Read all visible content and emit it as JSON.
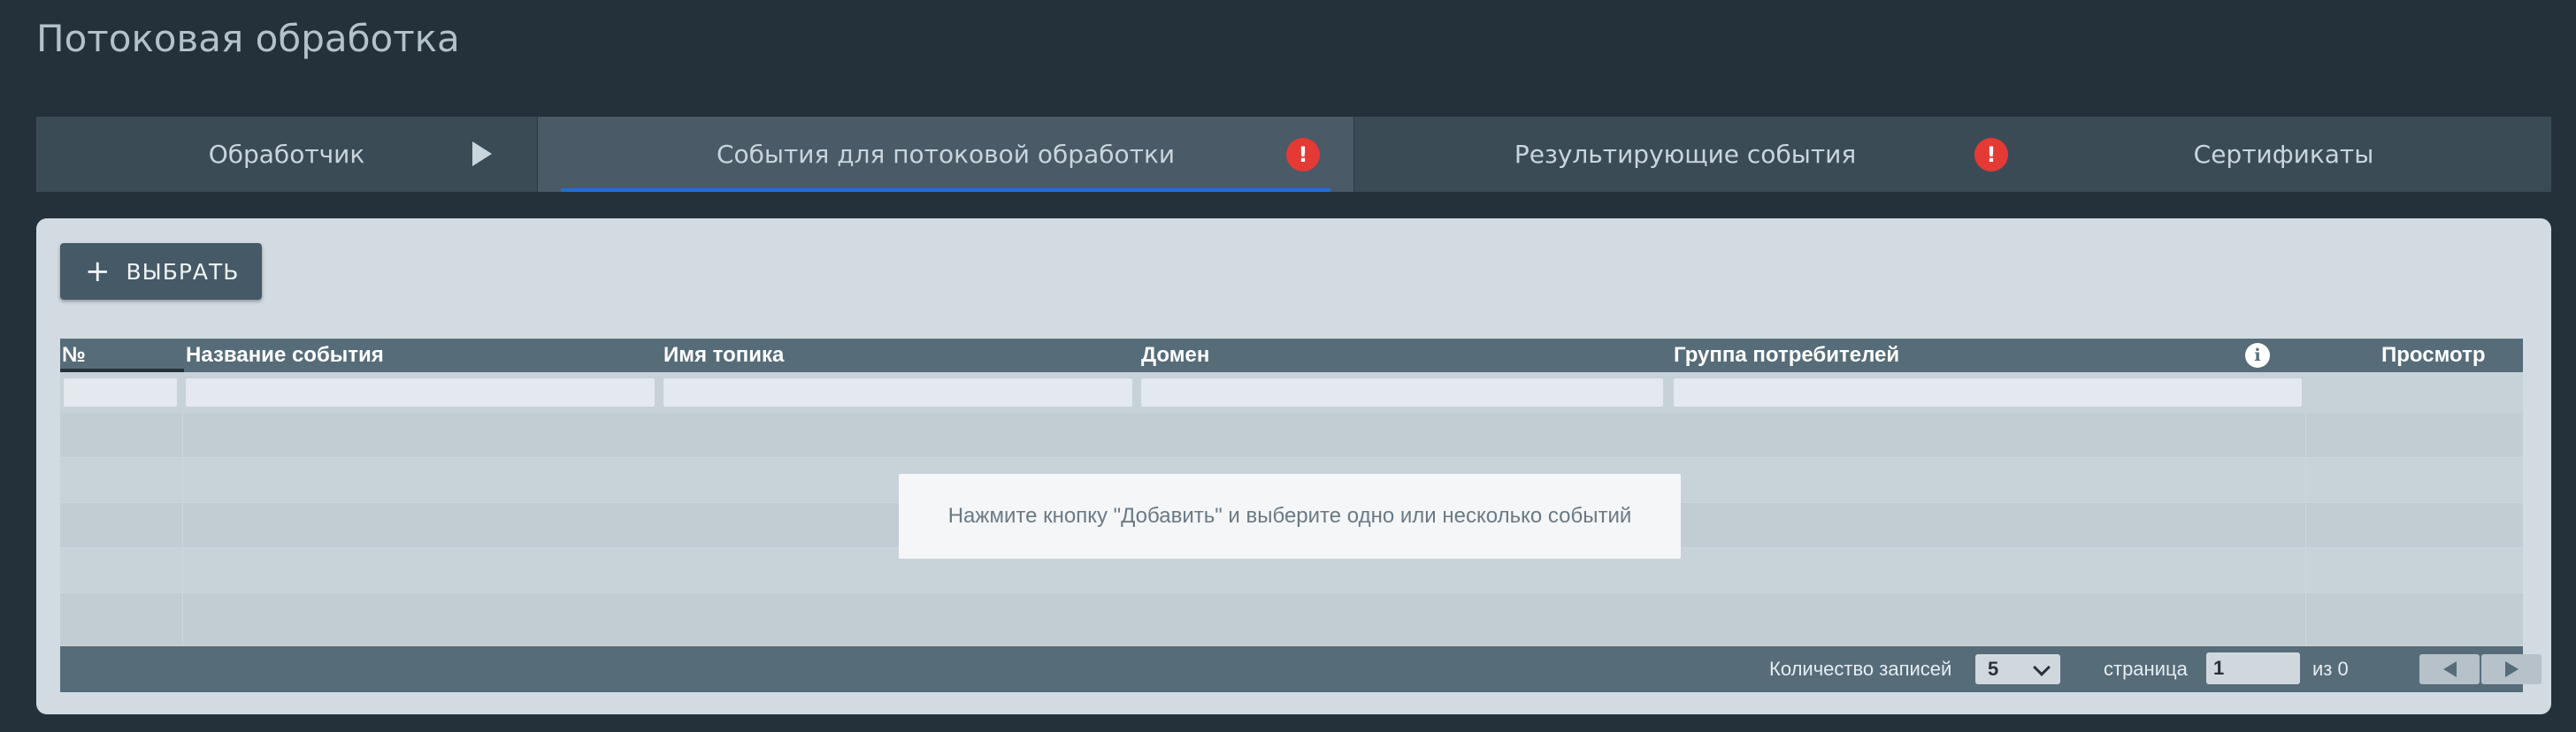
{
  "page": {
    "title": "Потоковая обработка"
  },
  "tabs": [
    {
      "label": "Обработчик",
      "icon": "play-icon"
    },
    {
      "label": "События для потоковой обработки",
      "icon": "alert-icon",
      "badge": "!",
      "active": true
    },
    {
      "label": "Результирующие события",
      "icon": "alert-icon",
      "badge": "!"
    },
    {
      "label": "Сертификаты"
    }
  ],
  "toolbar": {
    "select_icon": "+",
    "select_label": "ВЫБРАТЬ"
  },
  "grid": {
    "columns": [
      {
        "title": "№"
      },
      {
        "title": "Название события"
      },
      {
        "title": "Имя топика"
      },
      {
        "title": "Домен"
      },
      {
        "title": "Группа потребителей"
      },
      {
        "title": "Просмотр"
      }
    ],
    "info_icon": "i",
    "empty_message": "Нажмите кнопку \"Добавить\" и выберите одно или несколько событий"
  },
  "pagination": {
    "records_label": "Количество записей",
    "page_size": "5",
    "page_label": "страница",
    "page_value": "1",
    "of_label": "из 0"
  },
  "colors": {
    "background": "#25313a",
    "tab_bar": "#3b4b56",
    "active_tab": "#4a5a66",
    "active_underline": "#1e6fd9",
    "alert": "#e53935",
    "panel": "#d3dbe2",
    "grid_header": "#566c79"
  }
}
